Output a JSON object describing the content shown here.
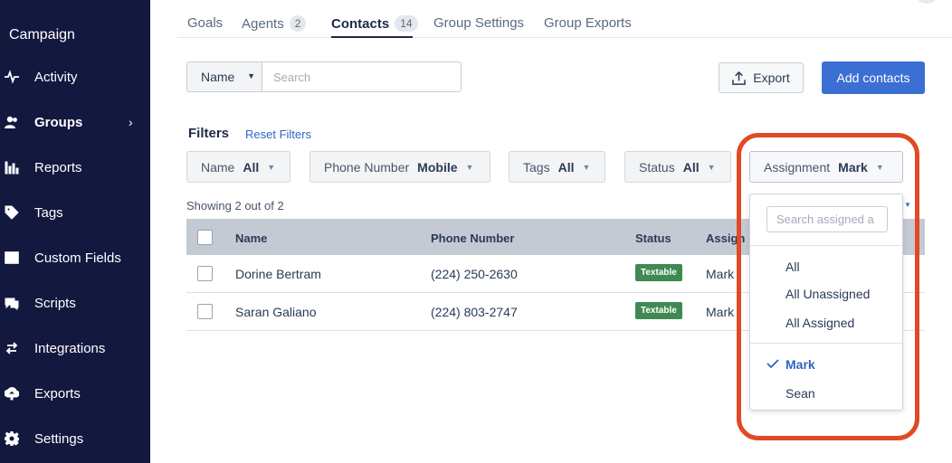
{
  "sidebar": {
    "title": "Campaign",
    "items": [
      {
        "label": "Activity",
        "icon": "activity-icon"
      },
      {
        "label": "Groups",
        "icon": "groups-icon",
        "active": true
      },
      {
        "label": "Reports",
        "icon": "reports-icon"
      },
      {
        "label": "Tags",
        "icon": "tag-icon"
      },
      {
        "label": "Custom Fields",
        "icon": "custom-fields-icon"
      },
      {
        "label": "Scripts",
        "icon": "scripts-icon"
      },
      {
        "label": "Integrations",
        "icon": "integrations-icon"
      },
      {
        "label": "Exports",
        "icon": "exports-icon"
      },
      {
        "label": "Settings",
        "icon": "gear-icon"
      }
    ],
    "groups_chevron": "›"
  },
  "tabs": [
    {
      "label": "Goals"
    },
    {
      "label": "Agents",
      "badge": "2"
    },
    {
      "label": "Contacts",
      "badge": "14",
      "active": true
    },
    {
      "label": "Group Settings"
    },
    {
      "label": "Group Exports"
    }
  ],
  "search": {
    "field_label": "Name",
    "placeholder": "Search"
  },
  "actions": {
    "export_label": "Export",
    "add_label": "Add contacts"
  },
  "filters": {
    "title": "Filters",
    "reset_label": "Reset Filters",
    "items": [
      {
        "label": "Name",
        "value": "All"
      },
      {
        "label": "Phone Number",
        "value": "Mobile"
      },
      {
        "label": "Tags",
        "value": "All"
      },
      {
        "label": "Status",
        "value": "All"
      },
      {
        "label": "Assignment",
        "value": "Mark"
      }
    ]
  },
  "table": {
    "showing": "Showing 2 out of 2",
    "headers": [
      "Name",
      "Phone Number",
      "Status",
      "Assign"
    ],
    "rows": [
      {
        "name": "Dorine Bertram",
        "phone": "(224) 250-2630",
        "status": "Textable",
        "assignee": "Mark"
      },
      {
        "name": "Saran Galiano",
        "phone": "(224) 803-2747",
        "status": "Textable",
        "assignee": "Mark"
      }
    ]
  },
  "assignment_dropdown": {
    "search_placeholder": "Search assigned a",
    "options_group1": [
      "All",
      "All Unassigned",
      "All Assigned"
    ],
    "options_group2": [
      "Mark",
      "Sean"
    ],
    "selected": "Mark"
  },
  "colors": {
    "sidebar_bg": "#13183f",
    "primary": "#3b6fd4",
    "textable_tag": "#3f8a52",
    "highlight": "#e04a24"
  }
}
